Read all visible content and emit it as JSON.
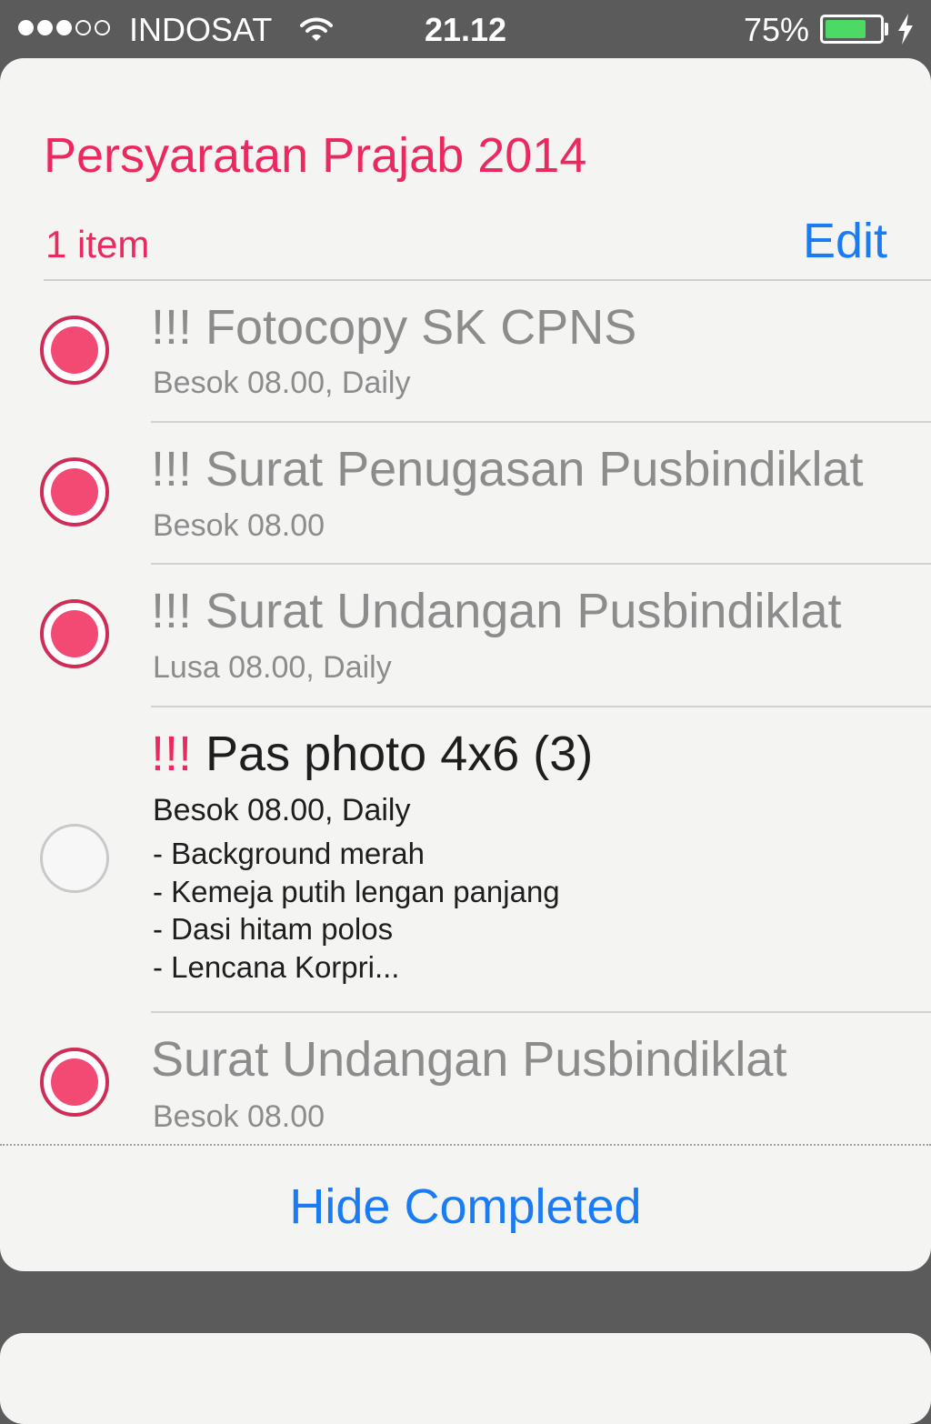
{
  "status_bar": {
    "signal": [
      "filled",
      "filled",
      "filled",
      "empty",
      "empty"
    ],
    "carrier": "INDOSAT",
    "time": "21.12",
    "battery_percent": "75%",
    "battery_level": 0.75,
    "battery_color": "#4cd964"
  },
  "list": {
    "title": "Persyaratan Prajab 2014",
    "count": "1 item",
    "edit_label": "Edit",
    "accent_color": "#ea2a5f",
    "items": [
      {
        "priority": "!!!",
        "title": "Fotocopy SK CPNS",
        "subtitle": "Besok 08.00, Daily",
        "completed": true
      },
      {
        "priority": "!!!",
        "title": "Surat Penugasan Pusbindiklat",
        "subtitle": "Besok 08.00",
        "completed": true
      },
      {
        "priority": "!!!",
        "title": "Surat Undangan Pusbindiklat",
        "subtitle": "Lusa 08.00, Daily",
        "completed": true
      },
      {
        "priority": "!!!",
        "title": "Pas photo 4x6 (3)",
        "subtitle": "Besok 08.00, Daily",
        "completed": false,
        "notes": [
          "- Background merah",
          "- Kemeja putih lengan panjang",
          "- Dasi hitam polos",
          "- Lencana Korpri..."
        ]
      },
      {
        "priority": "",
        "title": "Surat Undangan Pusbindiklat",
        "subtitle": "Besok 08.00",
        "completed": true
      }
    ],
    "hide_completed_label": "Hide Completed"
  }
}
